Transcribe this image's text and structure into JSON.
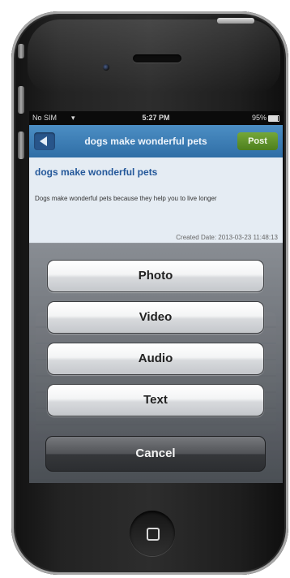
{
  "status_bar": {
    "carrier": "No SIM",
    "signal_icon": "wifi-icon",
    "time": "5:27 PM",
    "battery": "95%"
  },
  "nav_bar": {
    "back_icon": "back-arrow-icon",
    "title": "dogs make wonderful pets",
    "post_label": "Post"
  },
  "post": {
    "title": "dogs make wonderful pets",
    "body": "Dogs make wonderful pets because they help you to live longer",
    "created": "Created Date: 2013-03-23 11:48:13"
  },
  "action_sheet": {
    "options": [
      "Photo",
      "Video",
      "Audio",
      "Text"
    ],
    "cancel_label": "Cancel"
  },
  "colors": {
    "nav_blue": "#2f6ea6",
    "post_green": "#4d7f1e",
    "title_blue": "#24589a"
  }
}
